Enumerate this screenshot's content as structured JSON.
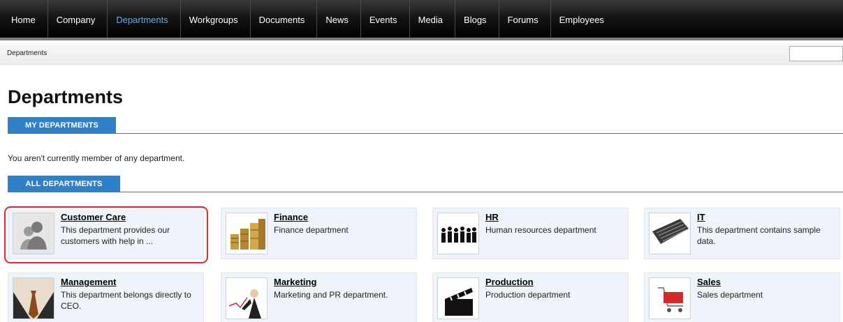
{
  "nav": {
    "items": [
      "Home",
      "Company",
      "Departments",
      "Workgroups",
      "Documents",
      "News",
      "Events",
      "Media",
      "Blogs",
      "Forums",
      "Employees"
    ],
    "active": "Departments"
  },
  "breadcrumb": "Departments",
  "search": {
    "value": ""
  },
  "page_title": "Departments",
  "sections": {
    "my": {
      "label": "MY DEPARTMENTS"
    },
    "all": {
      "label": "ALL DEPARTMENTS"
    }
  },
  "info_text": "You aren't currently member of any department.",
  "departments": [
    {
      "name": "Customer Care",
      "description": "This department provides our customers with help in ...",
      "icon": "person-silhouette-icon"
    },
    {
      "name": "Finance",
      "description": "Finance department",
      "icon": "coins-icon"
    },
    {
      "name": "HR",
      "description": "Human resources department",
      "icon": "people-group-icon"
    },
    {
      "name": "IT",
      "description": "This department contains sample data.",
      "icon": "keyboard-icon"
    },
    {
      "name": "Management",
      "description": "This department belongs directly to CEO.",
      "icon": "necktie-icon"
    },
    {
      "name": "Marketing",
      "description": "Marketing and PR department.",
      "icon": "presenter-chart-icon"
    },
    {
      "name": "Production",
      "description": "Production department",
      "icon": "clapperboard-icon"
    },
    {
      "name": "Sales",
      "description": "Sales department",
      "icon": "shopping-cart-icon"
    }
  ],
  "colors": {
    "accent": "#2f80c6",
    "highlight": "#e0262f",
    "card_bg": "#eef4f9"
  }
}
